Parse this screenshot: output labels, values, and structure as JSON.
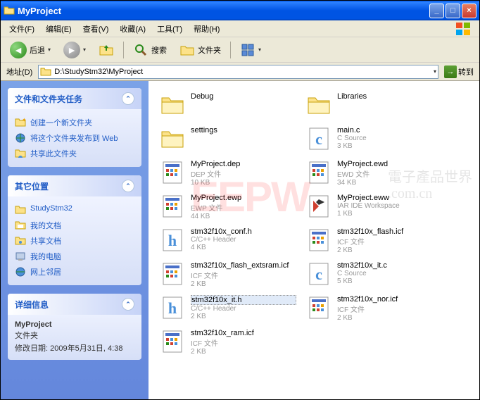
{
  "window": {
    "title": "MyProject"
  },
  "menu": {
    "file": "文件(F)",
    "edit": "编辑(E)",
    "view": "查看(V)",
    "favorites": "收藏(A)",
    "tools": "工具(T)",
    "help": "帮助(H)"
  },
  "toolbar": {
    "back": "后退",
    "search": "搜索",
    "folders": "文件夹"
  },
  "address": {
    "label": "地址(D)",
    "path": "D:\\StudyStm32\\MyProject",
    "go": "转到"
  },
  "sidebar": {
    "tasks": {
      "title": "文件和文件夹任务",
      "new_folder": "创建一个新文件夹",
      "publish": "将这个文件夹发布到 Web",
      "share": "共享此文件夹"
    },
    "places": {
      "title": "其它位置",
      "items": [
        "StudyStm32",
        "我的文档",
        "共享文档",
        "我的电脑",
        "网上邻居"
      ]
    },
    "details": {
      "title": "详细信息",
      "name": "MyProject",
      "type": "文件夹",
      "modified": "修改日期: 2009年5月31日, 4:38"
    }
  },
  "files": [
    {
      "name": "Debug",
      "type": "folder",
      "meta1": "",
      "meta2": ""
    },
    {
      "name": "Libraries",
      "type": "folder",
      "meta1": "",
      "meta2": ""
    },
    {
      "name": "settings",
      "type": "folder",
      "meta1": "",
      "meta2": ""
    },
    {
      "name": "main.c",
      "type": "c",
      "meta1": "C Source",
      "meta2": "3 KB"
    },
    {
      "name": "MyProject.dep",
      "type": "generic",
      "meta1": "DEP 文件",
      "meta2": "10 KB"
    },
    {
      "name": "MyProject.ewd",
      "type": "generic",
      "meta1": "EWD 文件",
      "meta2": "34 KB"
    },
    {
      "name": "MyProject.ewp",
      "type": "generic",
      "meta1": "EWP 文件",
      "meta2": "44 KB"
    },
    {
      "name": "MyProject.eww",
      "type": "iar",
      "meta1": "IAR IDE Workspace",
      "meta2": "1 KB"
    },
    {
      "name": "stm32f10x_conf.h",
      "type": "h",
      "meta1": "C/C++ Header",
      "meta2": "4 KB"
    },
    {
      "name": "stm32f10x_flash.icf",
      "type": "generic",
      "meta1": "ICF 文件",
      "meta2": "2 KB"
    },
    {
      "name": "stm32f10x_flash_extsram.icf",
      "type": "generic",
      "meta1": "ICF 文件",
      "meta2": "2 KB"
    },
    {
      "name": "stm32f10x_it.c",
      "type": "c",
      "meta1": "C Source",
      "meta2": "5 KB"
    },
    {
      "name": "stm32f10x_it.h",
      "type": "h",
      "meta1": "C/C++ Header",
      "meta2": "2 KB",
      "selected": true
    },
    {
      "name": "stm32f10x_nor.icf",
      "type": "generic",
      "meta1": "ICF 文件",
      "meta2": "2 KB"
    },
    {
      "name": "stm32f10x_ram.icf",
      "type": "generic",
      "meta1": "ICF 文件",
      "meta2": "2 KB"
    }
  ]
}
